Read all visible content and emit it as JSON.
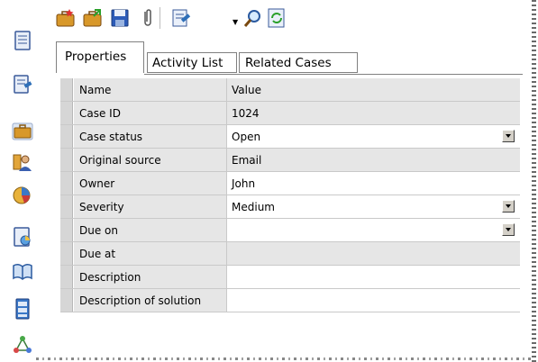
{
  "tabs": [
    {
      "label": "Properties",
      "active": true
    },
    {
      "label": "Activity List",
      "active": false
    },
    {
      "label": "Related Cases",
      "active": false
    }
  ],
  "grid": {
    "header": {
      "name": "Name",
      "value": "Value"
    },
    "rows": [
      {
        "name": "Case ID",
        "value": "1024",
        "editable": false,
        "dropdown": false
      },
      {
        "name": "Case status",
        "value": "Open",
        "editable": true,
        "dropdown": true
      },
      {
        "name": "Original source",
        "value": "Email",
        "editable": false,
        "dropdown": false
      },
      {
        "name": "Owner",
        "value": "John",
        "editable": true,
        "dropdown": false
      },
      {
        "name": "Severity",
        "value": "Medium",
        "editable": true,
        "dropdown": true
      },
      {
        "name": "Due on",
        "value": "",
        "editable": true,
        "dropdown": true
      },
      {
        "name": "Due at",
        "value": "",
        "editable": false,
        "dropdown": false
      },
      {
        "name": "Description",
        "value": "",
        "editable": true,
        "dropdown": false
      },
      {
        "name": "Description of solution",
        "value": "",
        "editable": true,
        "dropdown": false
      }
    ]
  },
  "toolbar_icons": [
    "new-case-icon",
    "open-case-icon",
    "save-icon",
    "attach-icon",
    "edit-icon",
    "search-icon",
    "refresh-icon"
  ],
  "left_icons": [
    "document-icon",
    "document-edit-icon",
    "briefcase-icon",
    "people-icon",
    "chart-icon",
    "report-icon",
    "book-icon",
    "cabinet-icon",
    "network-icon"
  ]
}
